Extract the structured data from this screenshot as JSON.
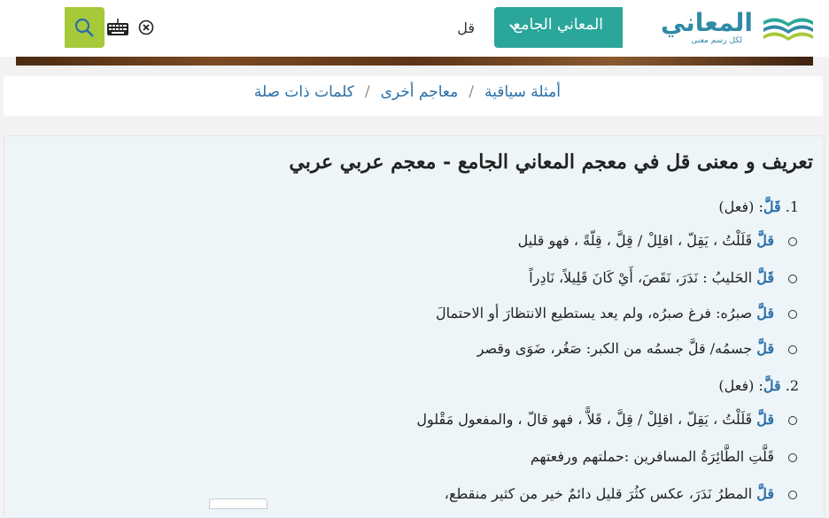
{
  "header": {
    "logo_text": "المعاني",
    "logo_tagline": "لكل رسم معنى",
    "dict_select": "المعاني الجامع",
    "search_value": "قل"
  },
  "breadcrumb": [
    "أمثلة سياقية",
    "معاجم أخرى",
    "كلمات ذات صلة"
  ],
  "article": {
    "title": "تعريف و معنى قل في معجم المعاني الجامع - معجم عربي عربي",
    "defs": [
      {
        "num": "1.",
        "head": "قَلَّ",
        "pos": ": (فعل)",
        "items": [
          {
            "w": "قلَّ",
            "t": " قَلَلْتُ ، يَقِلّ ، اقلِلْ / قِلَّ ، قِلّةً ، فهو قليل"
          },
          {
            "w": "قَلَّ",
            "t": " الحَليبُ : نَدَرَ، نَقَصَ، أَيْ كَانَ قَلِيلاً، نَادِراً"
          },
          {
            "w": "قلَّ",
            "t": " صبرُه: فرغ صبرُه، ولم يعد يستطيع الانتظارَ أو الاحتمالَ"
          },
          {
            "w": "قلَّ",
            "t": " جسمُه/ قلَّ جسمُه من الكبر: صَغُر، ضَوَى وقصر"
          }
        ]
      },
      {
        "num": "2.",
        "head": "قلَّ",
        "pos": ": (فعل)",
        "items": [
          {
            "w": "قلَّ",
            "t": " قَلَلْتُ ، يَقِلّ ، اقلِلْ / قِلَّ ، قَلاًّ ، فهو قالّ ، والمفعول مَقْلول"
          },
          {
            "w": "",
            "t": "قَلَّتِ الطَّائِرَةُ المسافرين :حملتهم ورفعتهم"
          },
          {
            "w": "قلَّ",
            "t": " المطرُ نَدَرَ، عكس كثُرَ قليل دائمٌ خير من كثير منقطع،"
          }
        ]
      }
    ]
  },
  "colors": {
    "accent_teal": "#2aa79a",
    "search_button": "#a6c93a",
    "link_blue": "#2a6fa8"
  }
}
